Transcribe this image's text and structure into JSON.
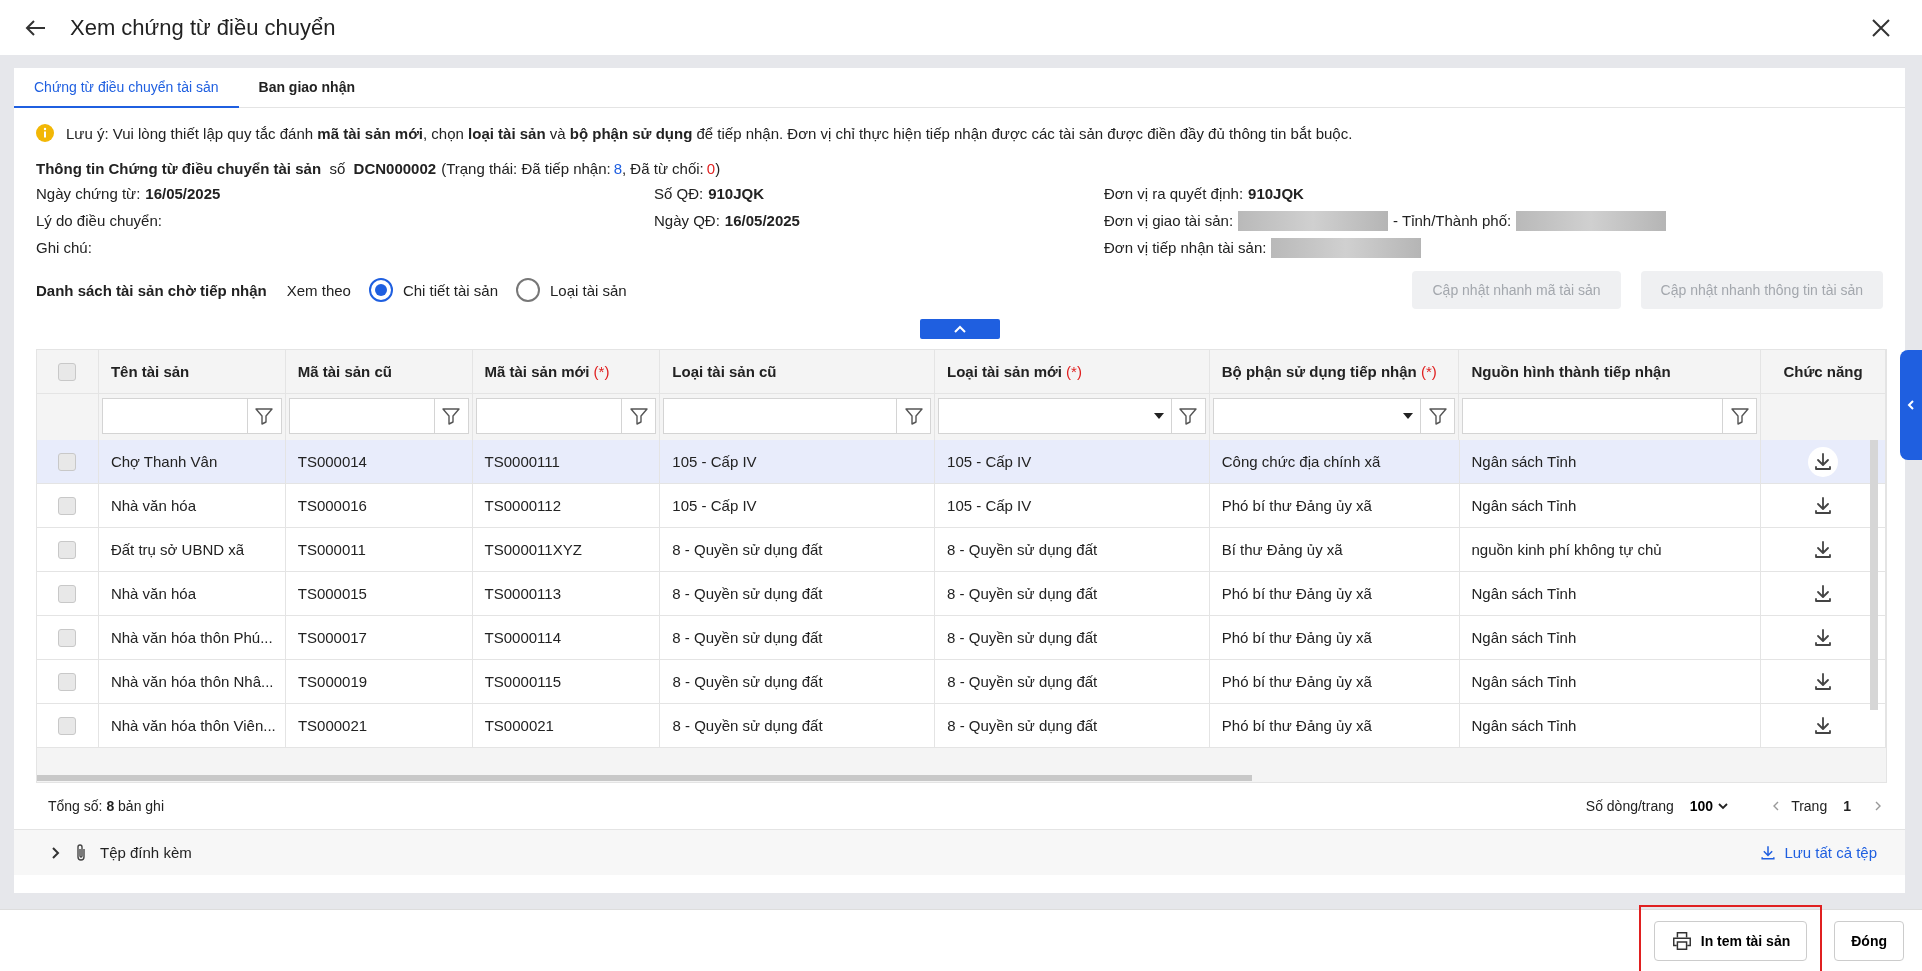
{
  "window": {
    "title": "Xem chứng từ điều chuyển"
  },
  "tabs": [
    {
      "label": "Chứng từ điều chuyển tài sản",
      "selected": true
    },
    {
      "label": "Ban giao nhận",
      "selected": false
    }
  ],
  "notice": "Lưu ý: Vui lòng thiết lập quy tắc đánh **mã tài sản mới**, chọn **loại tài sản** và **bộ phận sử dụng** để tiếp nhận. Đơn vị chỉ thực hiện tiếp nhận được các tài sản được điền đầy đủ thông tin bắt buộc.",
  "info": {
    "heading": "**Thông tin Chứng từ điều chuyển tài sản**  số  **DCN000002**",
    "status_open": "(Trạng thái: Đã tiếp nhận:",
    "received_count": "8",
    "status_mid": ", Đã từ chối:",
    "rejected_count": "0",
    "status_close": ")",
    "columns": [
      [
        [
          {
            "kind": "label",
            "text": "Ngày chứng từ:"
          },
          {
            "kind": "value",
            "text": "16/05/2025"
          }
        ],
        [
          {
            "kind": "label",
            "text": "Lý do điều chuyển:"
          }
        ],
        [
          {
            "kind": "label",
            "text": "Ghi chú:"
          }
        ]
      ],
      [
        [
          {
            "kind": "label",
            "text": "Số QĐ:"
          },
          {
            "kind": "value",
            "text": "910JQK"
          }
        ],
        [
          {
            "kind": "label",
            "text": "Ngày QĐ:"
          },
          {
            "kind": "value",
            "text": "16/05/2025"
          }
        ]
      ],
      [
        [
          {
            "kind": "label",
            "text": "Đơn vị ra quyết định:"
          },
          {
            "kind": "value",
            "text": "910JQK"
          }
        ],
        [
          {
            "kind": "label",
            "text": "Đơn vị giao tài sản:"
          },
          {
            "kind": "redacted"
          },
          {
            "kind": "label",
            "text": "- Tỉnh/Thành phố:"
          },
          {
            "kind": "redacted"
          }
        ],
        [
          {
            "kind": "label",
            "text": "Đơn vị tiếp nhận tài sản:"
          },
          {
            "kind": "redacted"
          }
        ]
      ]
    ]
  },
  "asset_list": {
    "title": "Danh sách tài sản chờ tiếp nhận",
    "view_label": "Xem theo",
    "view_options": [
      {
        "label": "Chi tiết tài sản",
        "selected": true
      },
      {
        "label": "Loại tài sản",
        "selected": false
      }
    ],
    "buttons": [
      {
        "label": "Cập nhật nhanh mã tài sản",
        "disabled": true
      },
      {
        "label": "Cập nhật nhanh thông tin tài sản",
        "disabled": true
      }
    ]
  },
  "table": {
    "columns": [
      {
        "label": "Tên tài sản",
        "kind": "text"
      },
      {
        "label": "Mã tài sản cũ",
        "kind": "text"
      },
      {
        "label": "Mã tài sản mới",
        "marker": "(*)",
        "kind": "text"
      },
      {
        "label": "Loại tài sản cũ",
        "kind": "text"
      },
      {
        "label": "Loại tài sản mới",
        "marker": "(*)",
        "kind": "dropdown"
      },
      {
        "label": "Bộ phận sử dụng tiếp nhận",
        "marker": "(*)",
        "kind": "dropdown"
      },
      {
        "label": "Nguồn hình thành tiếp nhận",
        "kind": "text"
      },
      {
        "label": "Chức năng",
        "kind": "none"
      }
    ],
    "select_all": {
      "checked": false
    },
    "rows": [
      {
        "selected": true,
        "checked": false,
        "cells": [
          "Chợ Thanh Vân",
          "TS000014",
          "TS0000111",
          "105 - Cấp IV",
          "105 - Cấp IV",
          "Công chức địa chính xã",
          "Ngân sách Tỉnh"
        ]
      },
      {
        "selected": false,
        "checked": false,
        "cells": [
          "Nhà văn hóa",
          "TS000016",
          "TS0000112",
          "105 - Cấp IV",
          "105 - Cấp IV",
          "Phó bí thư Đảng ủy xã",
          "Ngân sách Tỉnh"
        ]
      },
      {
        "selected": false,
        "checked": false,
        "cells": [
          "Đất trụ sở UBND xã",
          "TS000011",
          "TS000011XYZ",
          "8 - Quyền sử dụng đất",
          "8 - Quyền sử dụng đất",
          "Bí thư Đảng ủy xã",
          "nguồn kinh phí không tự chủ"
        ]
      },
      {
        "selected": false,
        "checked": false,
        "cells": [
          "Nhà văn hóa",
          "TS000015",
          "TS0000113",
          "8 - Quyền sử dụng đất",
          "8 - Quyền sử dụng đất",
          "Phó bí thư Đảng ủy xã",
          "Ngân sách Tỉnh"
        ]
      },
      {
        "selected": false,
        "checked": false,
        "cells": [
          "Nhà văn hóa thôn Phú...",
          "TS000017",
          "TS0000114",
          "8 - Quyền sử dụng đất",
          "8 - Quyền sử dụng đất",
          "Phó bí thư Đảng ủy xã",
          "Ngân sách Tỉnh"
        ]
      },
      {
        "selected": false,
        "checked": false,
        "cells": [
          "Nhà văn hóa thôn Nhâ...",
          "TS000019",
          "TS0000115",
          "8 - Quyền sử dụng đất",
          "8 - Quyền sử dụng đất",
          "Phó bí thư Đảng ủy xã",
          "Ngân sách Tỉnh"
        ]
      },
      {
        "selected": false,
        "checked": false,
        "cells": [
          "Nhà văn hóa thôn Viên...",
          "TS000021",
          "TS000021",
          "8 - Quyền sử dụng đất",
          "8 - Quyền sử dụng đất",
          "Phó bí thư Đảng ủy xã",
          "Ngân sách Tỉnh"
        ]
      }
    ]
  },
  "pager": {
    "total": "Tổng số: **8** bản ghi",
    "page_size_label": "Số dòng/trang",
    "page_size": "100",
    "page_label": "Trang",
    "page": "1"
  },
  "attachments": {
    "label": "Tệp đính kèm",
    "save_all": "Lưu tất cả tệp"
  },
  "footer": {
    "buttons": [
      {
        "label": "In tem tài sản",
        "kind": "print",
        "highlighted": true
      },
      {
        "label": "Đóng",
        "kind": "plain",
        "highlighted": false
      }
    ]
  }
}
